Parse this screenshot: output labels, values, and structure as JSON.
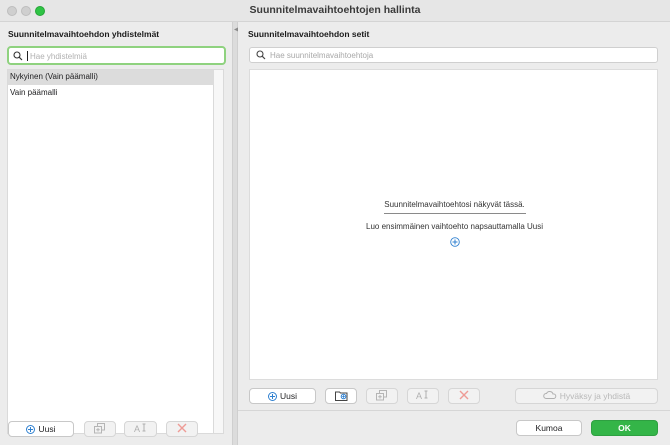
{
  "window": {
    "title": "Suunnitelmavaihtoehtojen hallinta"
  },
  "left_panel": {
    "heading": "Suunnitelmavaihtoehdon yhdistelmät",
    "search_placeholder": "Hae yhdistelmiä",
    "items": [
      {
        "label": "Nykyinen (Vain päämalli)",
        "selected": true
      },
      {
        "label": "Vain päämalli",
        "selected": false
      }
    ],
    "toolbar": {
      "new_label": "Uusi",
      "duplicate_icon": "duplicate-icon",
      "rename_icon": "rename-icon",
      "delete_icon": "delete-x-icon"
    }
  },
  "right_panel": {
    "heading": "Suunnitelmavaihtoehdon setit",
    "search_placeholder": "Hae suunnitelmavaihtoehtoja",
    "empty_state": {
      "title": "Suunnitelmavaihtoehtosi näkyvät tässä.",
      "hint": "Luo ensimmäinen vaihtoehto napsauttamalla Uusi"
    },
    "toolbar": {
      "new_label": "Uusi",
      "add_to_folder_icon": "folder-add-icon",
      "duplicate_icon": "duplicate-icon",
      "rename_icon": "rename-icon",
      "delete_icon": "delete-x-icon",
      "accept_label": "Hyväksy ja yhdistä"
    }
  },
  "footer": {
    "cancel_label": "Kumoa",
    "ok_label": "OK"
  },
  "colors": {
    "accent_green": "#34b548",
    "search_focus": "#8fd27f",
    "delete_red": "#e0605a",
    "add_blue": "#2f80d0"
  }
}
